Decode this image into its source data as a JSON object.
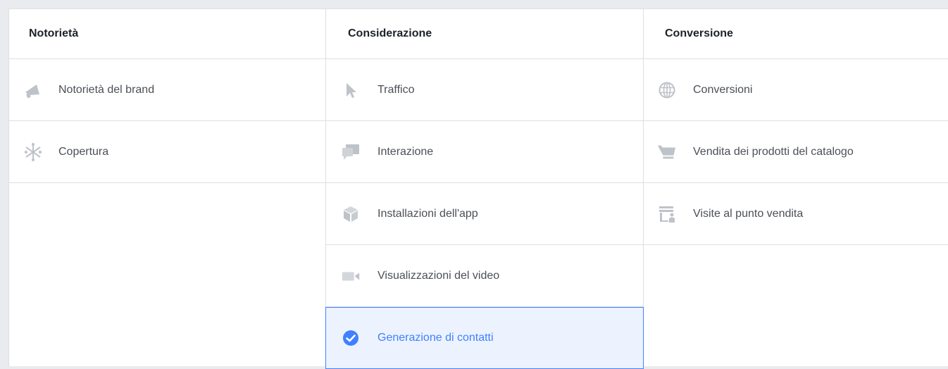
{
  "columns": [
    {
      "title": "Notorietà",
      "items": [
        {
          "label": "Notorietà del brand",
          "icon": "megaphone-icon"
        },
        {
          "label": "Copertura",
          "icon": "reach-icon"
        }
      ]
    },
    {
      "title": "Considerazione",
      "items": [
        {
          "label": "Traffico",
          "icon": "cursor-icon"
        },
        {
          "label": "Interazione",
          "icon": "chat-bubbles-icon"
        },
        {
          "label": "Installazioni dell'app",
          "icon": "box-icon"
        },
        {
          "label": "Visualizzazioni del video",
          "icon": "video-camera-icon"
        },
        {
          "label": "Generazione di contatti",
          "icon": "checkmark-icon",
          "selected": true
        }
      ]
    },
    {
      "title": "Conversione",
      "items": [
        {
          "label": "Conversioni",
          "icon": "globe-icon"
        },
        {
          "label": "Vendita dei prodotti del catalogo",
          "icon": "shopping-cart-icon"
        },
        {
          "label": "Visite al punto vendita",
          "icon": "store-icon"
        }
      ]
    }
  ],
  "colors": {
    "border": "#dddfe2",
    "icon_gray": "#bec3c9",
    "selected_bg": "#ecf3fe",
    "selected_accent": "#4080ff",
    "text": "#4b4f56"
  }
}
